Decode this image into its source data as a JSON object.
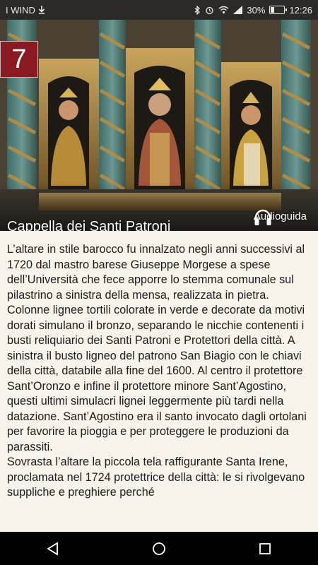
{
  "status_bar": {
    "carrier": "I WIND",
    "battery_percent": "30%",
    "battery_level": 0.3,
    "time": "12:26",
    "icons": [
      "download-icon",
      "bluetooth-icon",
      "alarm-icon",
      "wifi-icon",
      "signal-icon",
      "battery-icon"
    ]
  },
  "hero": {
    "number": "7",
    "title": "Cappella dei Santi Patroni",
    "audio_label": "Audioguida"
  },
  "article": {
    "paragraphs": [
      "L’altare in stile barocco fu innalzato negli anni successivi al 1720 dal mastro barese Giuseppe Morgese a spese dell’Università che fece apporre lo stemma comunale sul pilastrino a sinistra della mensa, realizzata in pietra. Colonne lignee tortili colorate in verde e decorate da motivi dorati simulano il bronzo, separando le nicchie contenenti i busti reliquiario dei Santi Patroni e Protettori della città. A sinistra il busto ligneo del patrono San Biagio con le chiavi della città, databile alla fine del 1600. Al centro il protettore Sant’Oronzo e infine il protettore minore Sant’Agostino, questi ultimi simulacri lignei leggermente più tardi nella datazione. Sant’Agostino era il santo invocato dagli ortolani  per favorire la pioggia e per proteggere le produzioni da parassiti.",
      "Sovrasta l’altare la piccola tela raffigurante Santa Irene, proclamata nel 1724 protettrice della città: le si rivolgevano suppliche e preghiere perché"
    ]
  },
  "nav": {
    "buttons": [
      "back-icon",
      "home-icon",
      "recents-icon"
    ]
  },
  "colors": {
    "badge": "#8a1a22",
    "content_bg": "#f7f3ea",
    "status_bg": "#2b2a28"
  }
}
